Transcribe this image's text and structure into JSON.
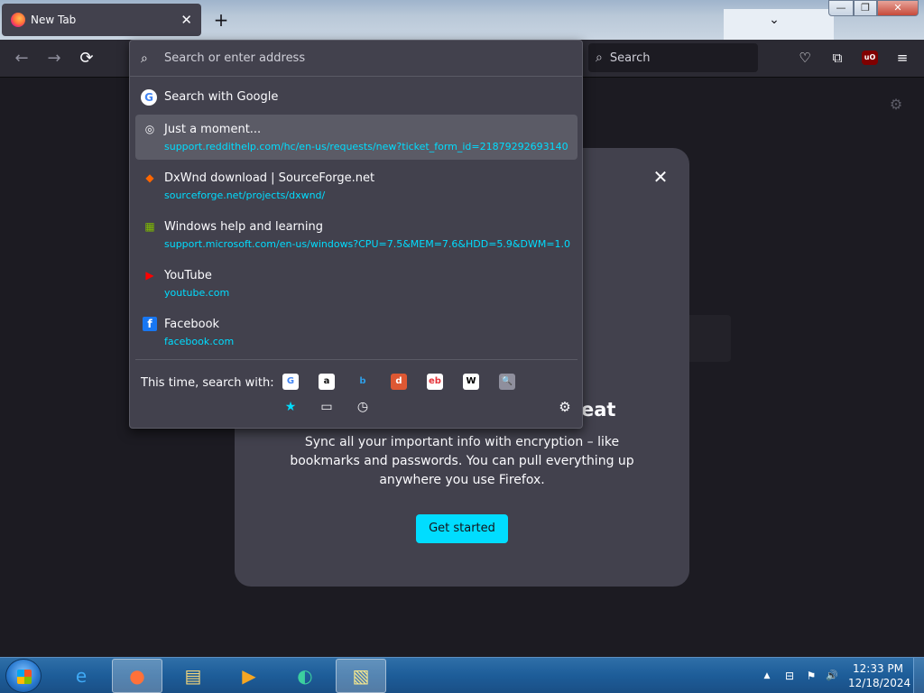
{
  "window": {
    "tab_title": "New Tab",
    "tab_close": "✕",
    "new_tab": "+",
    "list_all_tabs": "⌄",
    "minimize": "—",
    "maximize": "❐",
    "close": "✕"
  },
  "toolbar": {
    "back": "←",
    "forward": "→",
    "reload": "⟳",
    "search_placeholder": "Search",
    "pocket_icon": "♡",
    "extensions_icon": "⧉",
    "ublock_label": "uO",
    "menu_icon": "≡"
  },
  "urlbar": {
    "placeholder": "Search or enter address",
    "search_with": "Search with Google",
    "results": [
      {
        "title": "Just a moment...",
        "url": "support.reddithelp.com/hc/en-us/requests/new?ticket_form_id=21879292693140",
        "icon": "globe-icon",
        "glyph": "◎",
        "selected": true
      },
      {
        "title": "DxWnd download | SourceForge.net",
        "url": "sourceforge.net/projects/dxwnd/",
        "icon": "sourceforge-icon",
        "glyph": "◆",
        "selected": false
      },
      {
        "title": "Windows help and learning",
        "url": "support.microsoft.com/en-us/windows?CPU=7.5&MEM=7.6&HDD=5.9&DWM=1.0...",
        "icon": "microsoft-icon",
        "glyph": "▦",
        "selected": false
      },
      {
        "title": "YouTube",
        "url": "youtube.com",
        "icon": "youtube-icon",
        "glyph": "▶",
        "selected": false
      },
      {
        "title": "Facebook",
        "url": "facebook.com",
        "icon": "facebook-icon",
        "glyph": "f",
        "selected": false
      }
    ],
    "oneoff_label": "This time, search with:",
    "engines": [
      {
        "name": "google-engine-icon",
        "glyph": "G",
        "bg": "#ffffff",
        "fg": "#4285f4"
      },
      {
        "name": "amazon-engine-icon",
        "glyph": "a",
        "bg": "#ffffff",
        "fg": "#111111"
      },
      {
        "name": "bing-engine-icon",
        "glyph": "b",
        "bg": "transparent",
        "fg": "#2f9ee6"
      },
      {
        "name": "duckduckgo-engine-icon",
        "glyph": "d",
        "bg": "#de5833",
        "fg": "#ffffff"
      },
      {
        "name": "ebay-engine-icon",
        "glyph": "eb",
        "bg": "#ffffff",
        "fg": "#e53238"
      },
      {
        "name": "wikipedia-engine-icon",
        "glyph": "W",
        "bg": "#ffffff",
        "fg": "#000000"
      },
      {
        "name": "search-engine-icon",
        "glyph": "🔍",
        "bg": "#8f8f9d",
        "fg": "#ffffff"
      }
    ],
    "modes": [
      {
        "name": "bookmarks-mode-icon",
        "glyph": "★"
      },
      {
        "name": "tabs-mode-icon",
        "glyph": "▭"
      },
      {
        "name": "history-mode-icon",
        "glyph": "◷"
      }
    ],
    "settings_icon": "⚙"
  },
  "page": {
    "settings_icon": "⚙",
    "modal_close": "✕",
    "heading_tail": "eat",
    "description": "Sync all your important info with encryption – like bookmarks and passwords. You can pull everything up anywhere you use Firefox.",
    "cta": "Get started"
  },
  "taskbar": {
    "apps": [
      {
        "name": "taskbar-ie",
        "glyph": "e",
        "color": "#3fa9f5",
        "active": false
      },
      {
        "name": "taskbar-firefox",
        "glyph": "●",
        "color": "#ff7139",
        "active": true
      },
      {
        "name": "taskbar-explorer",
        "glyph": "▤",
        "color": "#f5d67a",
        "active": false
      },
      {
        "name": "taskbar-media",
        "glyph": "▶",
        "color": "#f5a623",
        "active": false
      },
      {
        "name": "taskbar-app",
        "glyph": "◐",
        "color": "#3ccf9f",
        "active": false
      },
      {
        "name": "taskbar-notes",
        "glyph": "▧",
        "color": "#f7e98e",
        "active": true
      }
    ],
    "tray_arrow": "▲",
    "tray_network": "⊟",
    "tray_flag": "⚑",
    "tray_volume": "🔊",
    "time": "12:33 PM",
    "date": "12/18/2024"
  },
  "colors": {
    "accent": "#00ddff",
    "panel": "#42414d",
    "selected_row": "#5b5b66"
  }
}
